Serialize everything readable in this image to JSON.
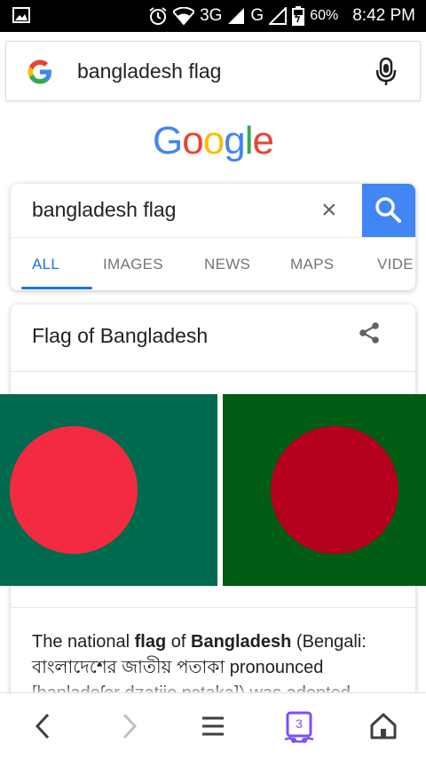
{
  "status_bar": {
    "network": "3G",
    "network2": "G",
    "battery": "60%",
    "time": "8:42 PM"
  },
  "top_search": {
    "query": "bangladesh flag"
  },
  "logo": {
    "letters": [
      "G",
      "o",
      "o",
      "g",
      "l",
      "e"
    ],
    "colors": [
      "#4285f4",
      "#ea4335",
      "#fbbc05",
      "#4285f4",
      "#34a853",
      "#ea4335"
    ]
  },
  "search_box": {
    "query": "bangladesh flag",
    "clear_label": "×"
  },
  "tabs": [
    {
      "label": "ALL"
    },
    {
      "label": "IMAGES"
    },
    {
      "label": "NEWS"
    },
    {
      "label": "MAPS"
    },
    {
      "label": "VIDE"
    }
  ],
  "knowledge_panel": {
    "title": "Flag of Bangladesh",
    "description_prefix": "The national ",
    "description_bold1": "flag",
    "description_mid": " of ",
    "description_bold2": "Bangladesh",
    "description_rest": " (Bengali: বাংলাদেশের জাতীয় পতাকা pronounced [baŋladeʃer dʒatijo pɔtaka]) was adopted"
  },
  "bottom_nav": {
    "tab_count": "3"
  },
  "colors": {
    "accent": "#1a73e8",
    "search_button": "#4285f4",
    "flag1_green": "#006a4e",
    "flag1_red": "#f42a41",
    "flag2_green": "#005c13",
    "flag2_red": "#b4001e"
  }
}
